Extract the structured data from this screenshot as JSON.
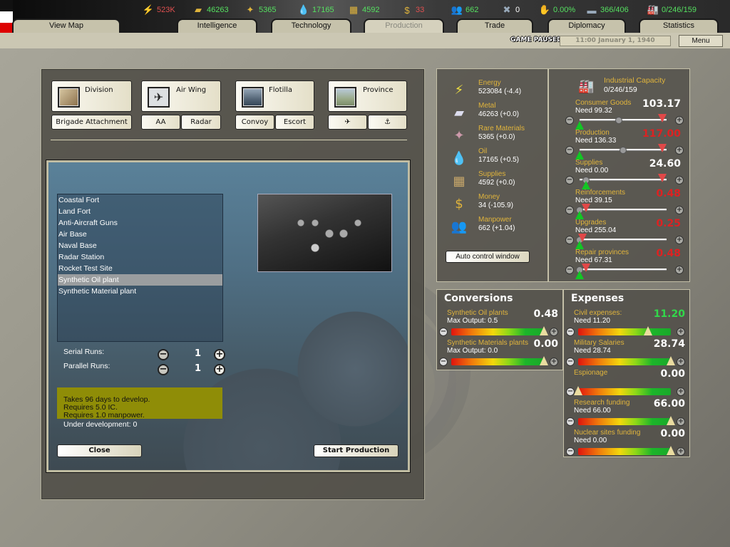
{
  "topbar": {
    "resources": [
      {
        "name": "energy",
        "icon": "⚡",
        "value": "523K",
        "color": "#e05050"
      },
      {
        "name": "metal",
        "icon": "▰",
        "value": "46263",
        "color": "#55e060"
      },
      {
        "name": "rare-materials",
        "icon": "✦",
        "value": "5365",
        "color": "#55e060"
      },
      {
        "name": "oil",
        "icon": "💧",
        "value": "17165",
        "color": "#55e060"
      },
      {
        "name": "supplies",
        "icon": "▦",
        "value": "4592",
        "color": "#55e060"
      },
      {
        "name": "money",
        "icon": "$",
        "value": "33",
        "color": "#e05050"
      }
    ],
    "stats": [
      {
        "name": "manpower",
        "icon": "👥",
        "value": "662",
        "color": "#55e060"
      },
      {
        "name": "nuclear",
        "icon": "✖",
        "value": "0",
        "color": "#ffffff"
      },
      {
        "name": "dissent",
        "icon": "✋",
        "value": "0.00%",
        "color": "#55e060"
      },
      {
        "name": "transport",
        "icon": "▬",
        "value": "366/406",
        "color": "#55e060"
      },
      {
        "name": "industrial-capacity",
        "icon": "🏭",
        "value": "0/246/159",
        "color": "#55e060"
      }
    ],
    "tabs": [
      {
        "label": "View Map",
        "active": false
      },
      {
        "label": "Intelligence",
        "active": false
      },
      {
        "label": "Technology",
        "active": false
      },
      {
        "label": "Production",
        "active": true
      },
      {
        "label": "Trade",
        "active": false
      },
      {
        "label": "Diplomacy",
        "active": false
      },
      {
        "label": "Statistics",
        "active": false
      }
    ],
    "status": "GAME PAUSED",
    "date": "11:00 January 1, 1940",
    "menu_label": "Menu"
  },
  "production": {
    "unit_buttons": [
      {
        "label": "Division",
        "icon": "tank-icon"
      },
      {
        "label": "Air Wing",
        "icon": "plane-icon"
      },
      {
        "label": "Flotilla",
        "icon": "ship-icon"
      },
      {
        "label": "Province",
        "icon": "province-icon"
      }
    ],
    "sub_buttons": {
      "brigade": "Brigade Attachment",
      "aa": "AA",
      "radar": "Radar",
      "convoy": "Convoy",
      "escort": "Escort",
      "aa_symbol": "✈",
      "anchor_symbol": "⚓"
    },
    "building_list": [
      "Coastal Fort",
      "Land Fort",
      "Anti-Aircraft Guns",
      "Air Base",
      "Naval Base",
      "Radar Station",
      "Rocket Test Site",
      "Synthetic Oil plant",
      "Synthetic  Material plant"
    ],
    "selected_index": 7,
    "serial_runs_label": "Serial Runs:",
    "serial_runs_value": "1",
    "parallel_runs_label": "Parallel Runs:",
    "parallel_runs_value": "1",
    "info_lines": [
      "Takes 96 days to develop.",
      "Requires 5.0 IC.",
      "Requires 1.0 manpower."
    ],
    "under_development": "Under development: 0",
    "close_label": "Close",
    "start_label": "Start Production"
  },
  "resources_panel": {
    "items": [
      {
        "name": "Energy",
        "value": "523084 (-4.4)",
        "icon": "⚡",
        "color": "#f0e040"
      },
      {
        "name": "Metal",
        "value": "46263 (+0.0)",
        "icon": "▰",
        "color": "#dde"
      },
      {
        "name": "Rare Materials",
        "value": "5365 (+0.0)",
        "icon": "✦",
        "color": "#c9a"
      },
      {
        "name": "Oil",
        "value": "17165 (+0.5)",
        "icon": "💧",
        "color": "#5bc"
      },
      {
        "name": "Supplies",
        "value": "4592 (+0.0)",
        "icon": "▦",
        "color": "#c9a86a"
      },
      {
        "name": "Money",
        "value": "34 (-105.9)",
        "icon": "$",
        "color": "#e0b43c"
      },
      {
        "name": "Manpower",
        "value": "662 (+1.04)",
        "icon": "👥",
        "color": "#6ab"
      }
    ],
    "auto_control_label": "Auto control window",
    "ic_label": "Industrial Capacity",
    "ic_value": "0/246/159"
  },
  "ic_sliders": [
    {
      "name": "Consumer Goods",
      "need": "Need 99.32",
      "amount": "103.17",
      "red": false,
      "need_pos": 0.0,
      "alloc_pos": 0.95,
      "knob": 0.45
    },
    {
      "name": "Production",
      "need": "Need 136.33",
      "amount": "117.00",
      "red": true,
      "need_pos": 0.0,
      "alloc_pos": 0.95,
      "knob": 0.5
    },
    {
      "name": "Supplies",
      "need": "Need 0.00",
      "amount": "24.60",
      "red": false,
      "need_pos": 0.07,
      "alloc_pos": 0.95,
      "knob": 0.07
    },
    {
      "name": "Reinforcements",
      "need": "Need 39.15",
      "amount": "0.48",
      "red": true,
      "need_pos": 0.0,
      "alloc_pos": 0.07,
      "knob": 0.0
    },
    {
      "name": "Upgrades",
      "need": "Need 255.04",
      "amount": "0.25",
      "red": true,
      "need_pos": 0.0,
      "alloc_pos": 0.03,
      "knob": 0.0
    },
    {
      "name": "Repair provinces",
      "need": "Need 67.31",
      "amount": "0.48",
      "red": true,
      "need_pos": 0.0,
      "alloc_pos": 0.07,
      "knob": 0.0
    }
  ],
  "conversions": {
    "title": "Conversions",
    "items": [
      {
        "name": "Synthetic Oil plants",
        "sub": "Max Output: 0.5",
        "amount": "0.48",
        "pos": 1.0
      },
      {
        "name": "Synthetic Materials plants",
        "sub": "Max Output: 0.0",
        "amount": "0.00",
        "pos": 1.0
      }
    ]
  },
  "expenses": {
    "title": "Expenses",
    "items": [
      {
        "name": "Civil expenses:",
        "sub": "Need 11.20",
        "amount": "11.20",
        "green": true,
        "pos": 0.75
      },
      {
        "name": "Military Salaries",
        "sub": "Need 28.74",
        "amount": "28.74",
        "green": false,
        "pos": 1.0
      },
      {
        "name": "Espionage",
        "sub": "",
        "amount": "0.00",
        "green": false,
        "pos": 0.0
      },
      {
        "name": "Research funding",
        "sub": "Need 66.00",
        "amount": "66.00",
        "green": false,
        "pos": 1.0
      },
      {
        "name": "Nuclear sites funding",
        "sub": "Need 0.00",
        "amount": "0.00",
        "green": false,
        "pos": 1.0
      }
    ]
  }
}
